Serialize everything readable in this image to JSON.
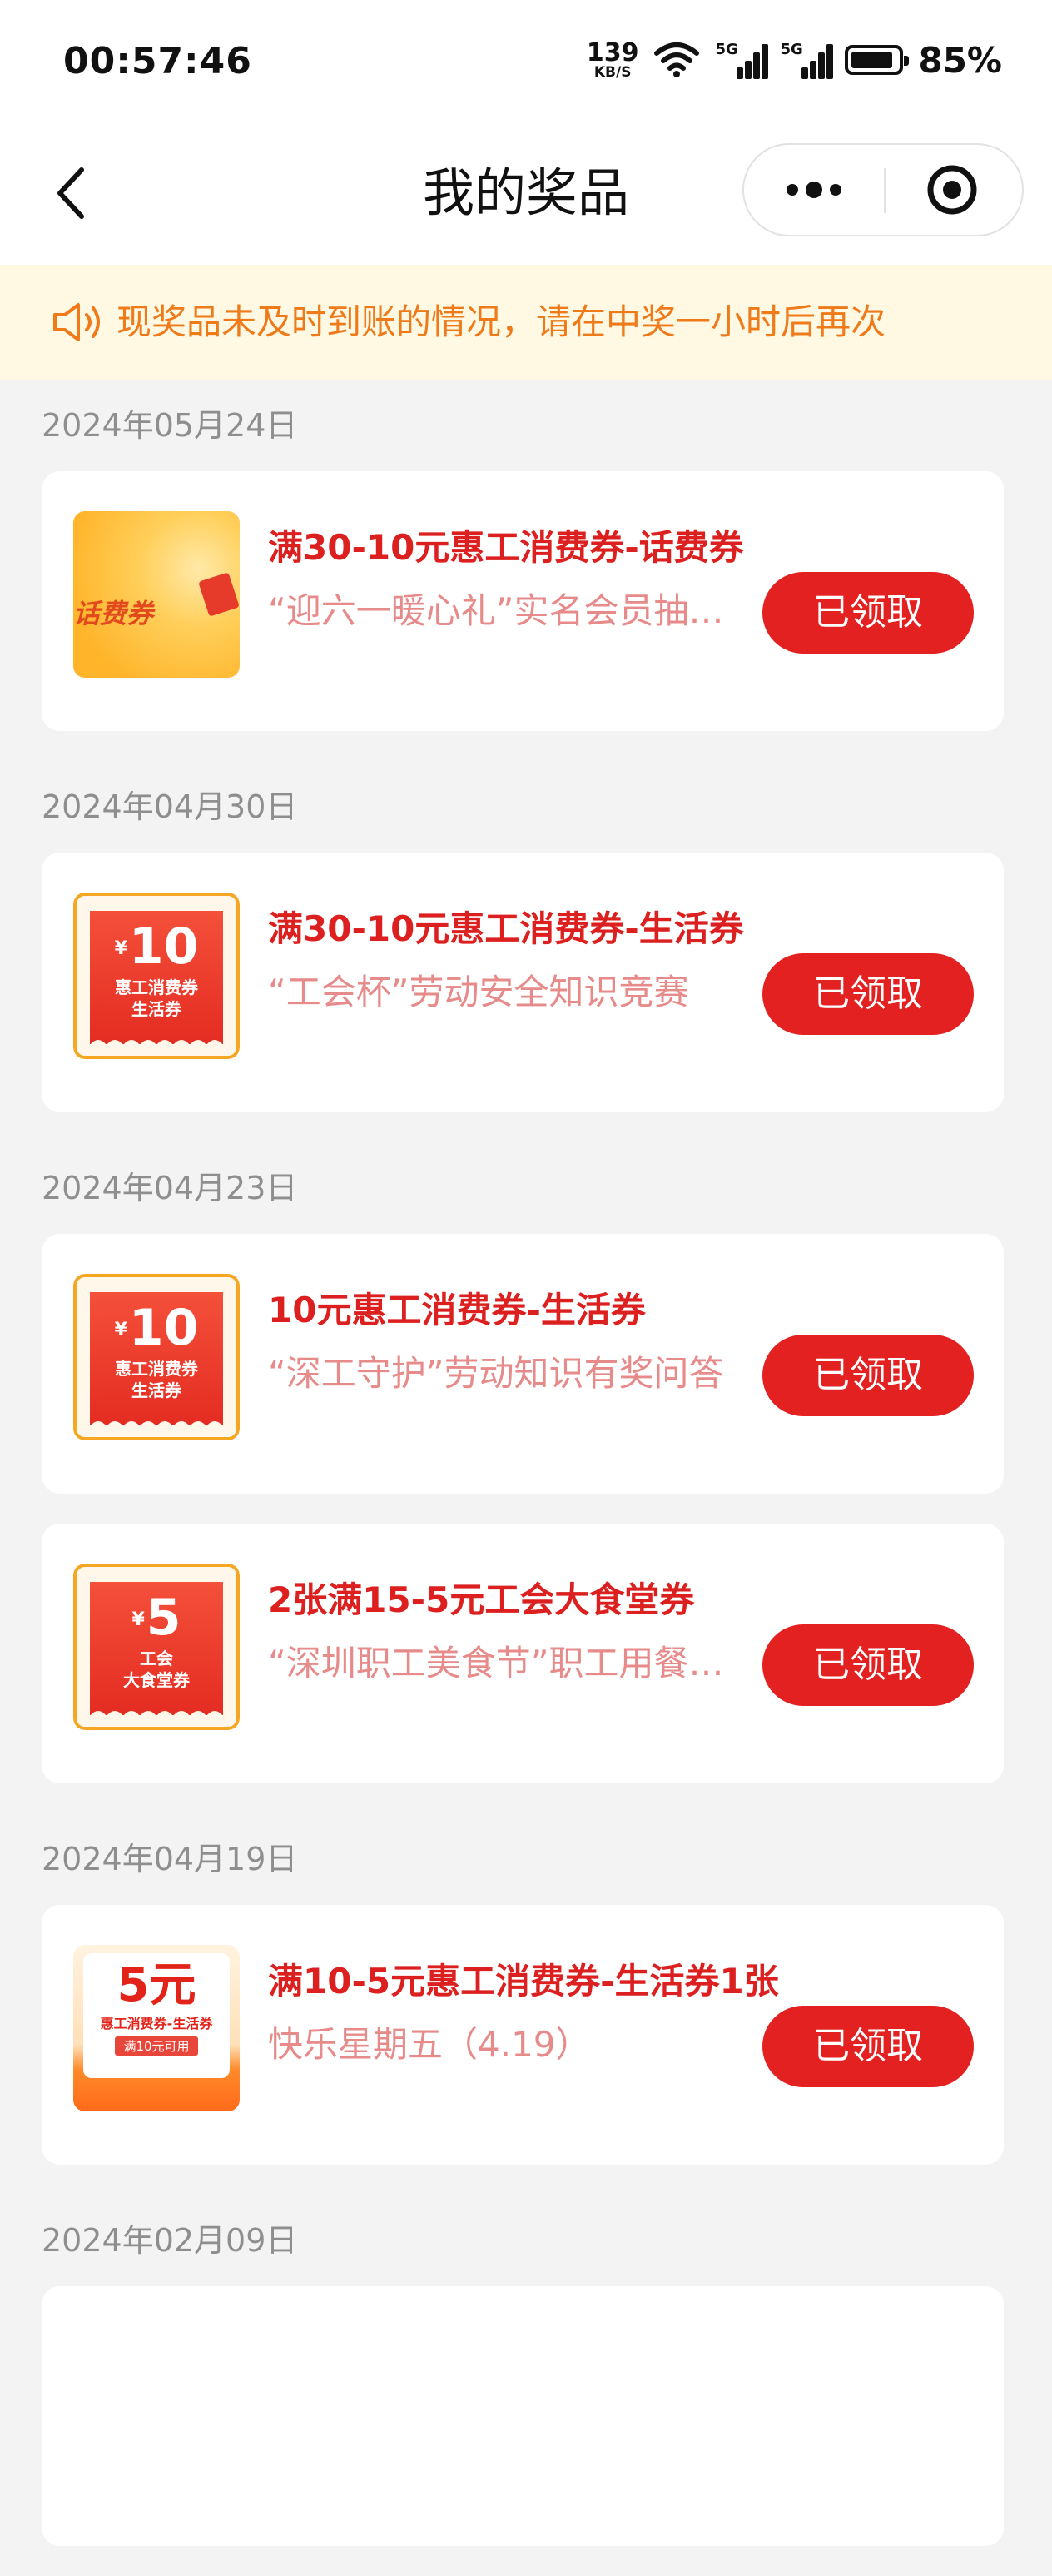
{
  "status": {
    "time": "00:57:46",
    "net_speed": "139",
    "net_unit": "KB/S",
    "sig1": "5G",
    "sig2": "5G",
    "battery": "85%"
  },
  "nav": {
    "title": "我的奖品"
  },
  "notice": {
    "text": "现奖品未及时到账的情况，请在中奖一小时后再次"
  },
  "colors": {
    "accent": "#e32121",
    "title_red": "#dc1f1f",
    "notice_orange": "#ee7a1a",
    "notice_bg": "#fff8e3"
  },
  "groups": [
    {
      "date": "2024年05月24日",
      "prizes": [
        {
          "thumb_text": "话费券",
          "title": "满30-10元惠工消费券-话费券",
          "source": "“迎六一暖心礼”实名会员抽奖活动",
          "button": "已领取"
        }
      ]
    },
    {
      "date": "2024年04月30日",
      "prizes": [
        {
          "thumb_amount": "10",
          "thumb_yen": "¥",
          "thumb_l1": "惠工消费券",
          "thumb_l2": "生活券",
          "title": "满30-10元惠工消费券-生活券",
          "source": "“工会杯”劳动安全知识竞赛",
          "button": "已领取"
        }
      ]
    },
    {
      "date": "2024年04月23日",
      "prizes": [
        {
          "thumb_amount": "10",
          "thumb_yen": "¥",
          "thumb_l1": "惠工消费券",
          "thumb_l2": "生活券",
          "title": "10元惠工消费券-生活券",
          "source": "“深工守护”劳动知识有奖问答",
          "button": "已领取"
        },
        {
          "thumb_amount": "5",
          "thumb_yen": "¥",
          "thumb_l1": "工会",
          "thumb_l2": "大食堂券",
          "title": "2张满15-5元工会大食堂券",
          "source": "“深圳职工美食节”职工用餐补贴",
          "button": "已领取"
        }
      ]
    },
    {
      "date": "2024年04月19日",
      "prizes": [
        {
          "thumb_amount": "5元",
          "thumb_l1": "惠工消费券-生活券",
          "thumb_l2": "满10元可用",
          "title": "满10-5元惠工消费券-生活券1张",
          "source": "快乐星期五（4.19）",
          "button": "已领取"
        }
      ]
    },
    {
      "date": "2024年02月09日",
      "prizes": []
    }
  ]
}
